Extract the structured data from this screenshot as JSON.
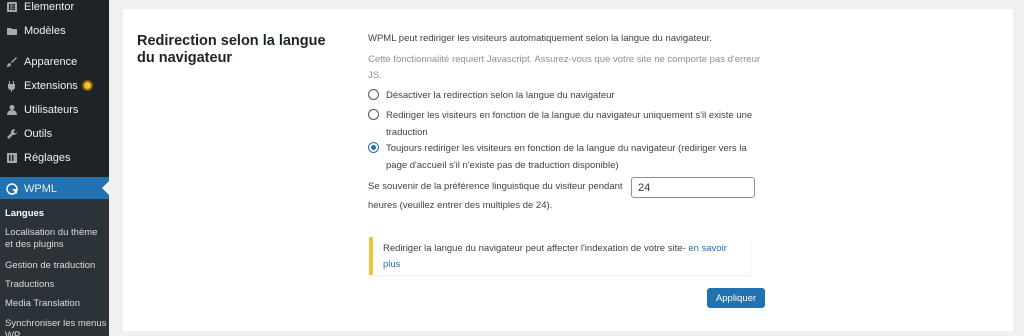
{
  "sidebar": {
    "items": [
      {
        "label": "Elementor",
        "icon": "elementor-icon"
      },
      {
        "label": "Modèles",
        "icon": "folder-icon"
      },
      {
        "label": "Apparence",
        "icon": "brush-icon"
      },
      {
        "label": "Extensions",
        "icon": "plugin-icon"
      },
      {
        "label": "Utilisateurs",
        "icon": "user-icon"
      },
      {
        "label": "Outils",
        "icon": "wrench-icon"
      },
      {
        "label": "Réglages",
        "icon": "settings-icon"
      },
      {
        "label": "WPML",
        "icon": "wpml-icon",
        "active": true
      }
    ],
    "submenu": [
      {
        "label": "Langues",
        "current": true
      },
      {
        "label": "Localisation du thème et des plugins"
      },
      {
        "label": "Gestion de traduction"
      },
      {
        "label": "Traductions"
      },
      {
        "label": "Media Translation"
      },
      {
        "label": "Synchroniser les menus WP"
      }
    ]
  },
  "section": {
    "title": "Redirection selon la langue du navigateur",
    "description": "WPML peut rediriger les visiteurs automatiquement selon la langue du navigateur.",
    "js_note": "Cette fonctionnalité requiert Javascript. Assurez-vous que votre site ne comporte pas d'erreur JS.",
    "options": [
      {
        "label": "Désactiver la redirection selon la langue du navigateur",
        "checked": false
      },
      {
        "label": "Rediriger les visiteurs en fonction de la langue du navigateur uniquement s'il existe une traduction",
        "checked": false
      },
      {
        "label": "Toujours rediriger les visiteurs en fonction de la langue du navigateur (rediriger vers la page d'accueil s'il n'existe pas de traduction disponible)",
        "checked": true
      }
    ],
    "remember_label": "Se souvenir de la préférence linguistique du visiteur pendant",
    "remember_value": "24",
    "remember_suffix": "heures (veuillez entrer des multiples de 24).",
    "notice_text": "Rediriger la langue du navigateur peut affecter l'indexation de votre site- ",
    "notice_link": "en savoir plus",
    "apply_label": "Appliquer"
  },
  "colors": {
    "sidebar_bg": "#1d2327",
    "accent": "#2271b1",
    "notice_border": "#f0c33c"
  }
}
